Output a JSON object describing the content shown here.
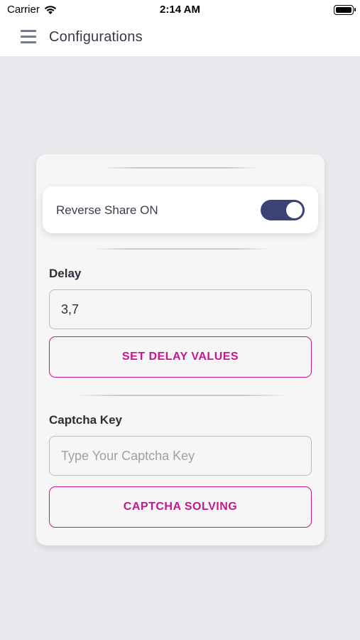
{
  "status_bar": {
    "carrier": "Carrier",
    "time": "2:14 AM"
  },
  "app_bar": {
    "title": "Configurations",
    "menu_icon": "hamburger-menu-icon"
  },
  "settings_card": {
    "reverse_share": {
      "label": "Reverse Share ON",
      "enabled": true
    },
    "delay": {
      "label": "Delay",
      "value": "3,7",
      "button_label": "SET DELAY VALUES"
    },
    "captcha": {
      "label": "Captcha Key",
      "placeholder": "Type Your Captcha Key",
      "value": "",
      "button_label": "CAPTCHA SOLVING"
    }
  },
  "colors": {
    "accent": "#c2188f",
    "toggle_on": "#3c4275",
    "background": "#e9eaed"
  }
}
